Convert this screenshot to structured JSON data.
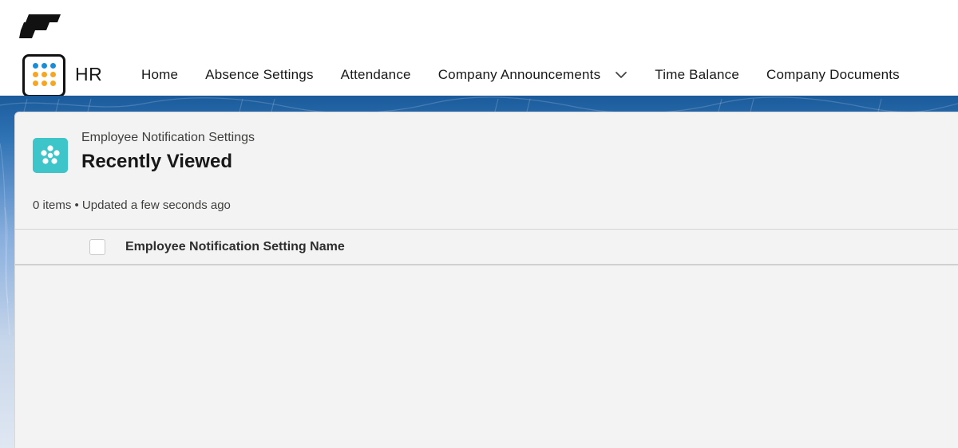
{
  "app": {
    "name": "HR"
  },
  "nav": {
    "items": [
      {
        "label": "Home"
      },
      {
        "label": "Absence Settings"
      },
      {
        "label": "Attendance"
      },
      {
        "label": "Company Announcements"
      },
      {
        "label": "Time Balance"
      },
      {
        "label": "Company Documents"
      }
    ]
  },
  "list": {
    "object_label": "Employee Notification Settings",
    "title": "Recently Viewed",
    "meta": "0 items • Updated a few seconds ago",
    "columns": [
      {
        "label": "Employee Notification Setting Name"
      }
    ],
    "rows": []
  },
  "icons": {
    "brand": "brand-logo-icon",
    "launcher": "app-launcher-icon",
    "object": "notification-settings-icon",
    "dropdown": "chevron-down-icon"
  },
  "colors": {
    "launcher_top_row": "#1b8cd8",
    "launcher_bottom_rows": "#f6a623",
    "object_icon_bg": "#3ec5c9",
    "band": "#1b5b9c"
  }
}
